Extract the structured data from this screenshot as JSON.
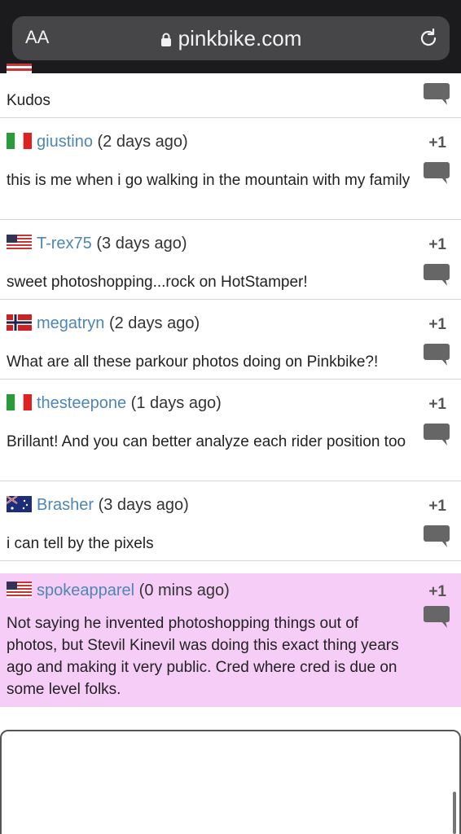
{
  "browser": {
    "text_size_label": "AA",
    "url": "pinkbike.com"
  },
  "first_comment": {
    "body": "Kudos"
  },
  "comments": [
    {
      "user": "giustino",
      "time": "(2 days ago)",
      "vote": "+1",
      "flag": "italy",
      "body": "this is me when i go walking in the mountain with my family"
    },
    {
      "user": "T-rex75",
      "time": "(3 days ago)",
      "vote": "+1",
      "flag": "usa",
      "body": "sweet photoshopping...rock on HotStamper!"
    },
    {
      "user": "megatryn",
      "time": "(2 days ago)",
      "vote": "+1",
      "flag": "norway",
      "body": "What are all these parkour photos doing on Pinkbike?!"
    },
    {
      "user": "thesteepone",
      "time": "(1 days ago)",
      "vote": "+1",
      "flag": "italy",
      "body": "Brillant! And you can better analyze each rider position too"
    },
    {
      "user": "Brasher",
      "time": "(3 days ago)",
      "vote": "+1",
      "flag": "australia",
      "body": "i can tell by the pixels"
    },
    {
      "user": "spokeapparel",
      "time": "(0 mins ago)",
      "vote": "+1",
      "flag": "usa",
      "body": "Not saying he invented photoshopping things out of photos, but Stevil Kinevil was doing this exact thing years ago and making it very public. Cred where cred is due on some level folks."
    }
  ],
  "colors": {
    "username": "#4f86b4",
    "highlight_bg": "#f5cdf6",
    "chrome_bg": "#1b1b1d",
    "address_bar": "#464648"
  }
}
